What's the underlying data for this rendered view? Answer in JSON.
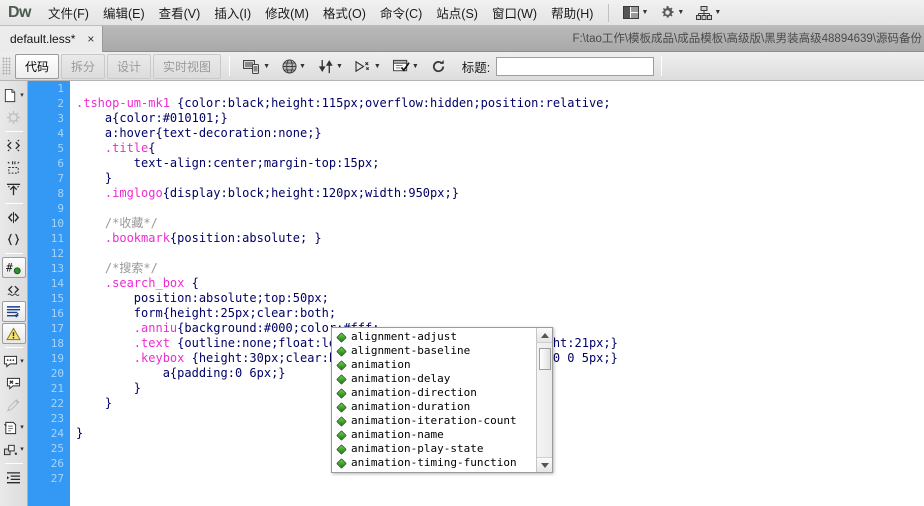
{
  "app": {
    "logo": "Dw",
    "window_path": "F:\\tao工作\\模板成品\\成品模板\\高级版\\黑男装高级48894639\\源码备份"
  },
  "menubar": {
    "items": [
      {
        "label": "文件(F)",
        "name": "menu-file"
      },
      {
        "label": "编辑(E)",
        "name": "menu-edit"
      },
      {
        "label": "查看(V)",
        "name": "menu-view"
      },
      {
        "label": "插入(I)",
        "name": "menu-insert"
      },
      {
        "label": "修改(M)",
        "name": "menu-modify"
      },
      {
        "label": "格式(O)",
        "name": "menu-format"
      },
      {
        "label": "命令(C)",
        "name": "menu-commands"
      },
      {
        "label": "站点(S)",
        "name": "menu-site"
      },
      {
        "label": "窗口(W)",
        "name": "menu-window"
      },
      {
        "label": "帮助(H)",
        "name": "menu-help"
      }
    ],
    "right_icons": [
      {
        "name": "layout-switcher-icon",
        "glyph": "layout"
      },
      {
        "name": "extend-gear-icon",
        "glyph": "gear"
      },
      {
        "name": "site-manage-icon",
        "glyph": "site"
      }
    ]
  },
  "tabbar": {
    "document_tab": {
      "label": "default.less*",
      "close": "×"
    }
  },
  "toolbar": {
    "view_buttons": [
      {
        "label": "代码",
        "active": true,
        "name": "view-code"
      },
      {
        "label": "拆分",
        "active": false,
        "name": "view-split"
      },
      {
        "label": "设计",
        "active": false,
        "name": "view-design"
      },
      {
        "label": "实时视图",
        "active": false,
        "name": "view-live"
      }
    ],
    "icons": [
      {
        "name": "multiscreen-preview-icon"
      },
      {
        "name": "preview-in-browser-icon"
      },
      {
        "name": "file-management-icon"
      },
      {
        "name": "live-code-icon"
      },
      {
        "name": "visual-aids-icon"
      },
      {
        "name": "refresh-icon"
      }
    ],
    "title_label": "标题:",
    "title_value": "",
    "title_placeholder": ""
  },
  "coding_toolbar": {
    "items": [
      {
        "name": "open-documents-icon",
        "glyph": "doc",
        "state": "normal"
      },
      {
        "name": "show-code-navigator-icon",
        "glyph": "wheel",
        "state": "disabled"
      },
      {
        "name": "collapse-full-tag-icon",
        "glyph": "collapse-tag",
        "state": "normal"
      },
      {
        "name": "collapse-outside-selection-icon",
        "glyph": "collapse-out",
        "state": "normal"
      },
      {
        "name": "expand-all-icon",
        "glyph": "expand",
        "state": "normal"
      },
      {
        "name": "select-parent-tag-icon",
        "glyph": "parent-tag",
        "state": "normal"
      },
      {
        "name": "balance-braces-icon",
        "glyph": "braces",
        "state": "normal"
      },
      {
        "name": "line-numbers-icon",
        "glyph": "hash",
        "state": "boxed"
      },
      {
        "name": "highlight-invalid-code-icon",
        "glyph": "invalid",
        "state": "normal"
      },
      {
        "name": "word-wrap-icon",
        "glyph": "wrap",
        "state": "boxed"
      },
      {
        "name": "syntax-error-alerts-icon",
        "glyph": "warn",
        "state": "boxed"
      },
      {
        "name": "apply-comment-icon",
        "glyph": "comment",
        "state": "normal"
      },
      {
        "name": "remove-comment-icon",
        "glyph": "uncomment",
        "state": "normal"
      },
      {
        "name": "wrap-tag-icon",
        "glyph": "pencil",
        "state": "disabled"
      },
      {
        "name": "recent-snippets-icon",
        "glyph": "snippet",
        "state": "normal"
      },
      {
        "name": "move-css-rules-icon",
        "glyph": "movecss",
        "state": "normal"
      },
      {
        "name": "indent-code-icon",
        "glyph": "indent",
        "state": "normal"
      }
    ]
  },
  "editor": {
    "line_numbers": [
      1,
      2,
      3,
      4,
      5,
      6,
      7,
      8,
      9,
      10,
      11,
      12,
      13,
      14,
      15,
      16,
      17,
      18,
      19,
      20,
      21,
      22,
      23,
      24,
      25,
      26,
      27
    ],
    "lines": [
      {
        "n": 1,
        "segments": []
      },
      {
        "n": 2,
        "segments": [
          {
            "t": ".tshop-um-mk1 ",
            "c": "tok-sel"
          },
          {
            "t": "{color:black;height:115px;overflow:hidden;position:relative;",
            "c": "tok-txt"
          }
        ]
      },
      {
        "n": 3,
        "segments": [
          {
            "t": "    a",
            "c": "tok-txt"
          },
          {
            "t": "{color:#010101;}",
            "c": "tok-txt"
          }
        ]
      },
      {
        "n": 4,
        "segments": [
          {
            "t": "    a:hover",
            "c": "tok-txt"
          },
          {
            "t": "{text-decoration:none;}",
            "c": "tok-txt"
          }
        ]
      },
      {
        "n": 5,
        "segments": [
          {
            "t": "    .title",
            "c": "tok-sel"
          },
          {
            "t": "{",
            "c": "tok-txt"
          }
        ]
      },
      {
        "n": 6,
        "segments": [
          {
            "t": "        text-align:center;margin-top:15px;",
            "c": "tok-txt"
          }
        ]
      },
      {
        "n": 7,
        "segments": [
          {
            "t": "    }",
            "c": "tok-txt"
          }
        ]
      },
      {
        "n": 8,
        "segments": [
          {
            "t": "    .imglogo",
            "c": "tok-sel"
          },
          {
            "t": "{display:block;height:120px;width:950px;}",
            "c": "tok-txt"
          }
        ]
      },
      {
        "n": 9,
        "segments": []
      },
      {
        "n": 10,
        "segments": [
          {
            "t": "    /*收藏*/",
            "c": "tok-cmt"
          }
        ]
      },
      {
        "n": 11,
        "segments": [
          {
            "t": "    .bookmark",
            "c": "tok-sel"
          },
          {
            "t": "{position:absolute; }",
            "c": "tok-txt"
          }
        ]
      },
      {
        "n": 12,
        "segments": []
      },
      {
        "n": 13,
        "segments": [
          {
            "t": "    /*搜索*/",
            "c": "tok-cmt"
          }
        ]
      },
      {
        "n": 14,
        "segments": [
          {
            "t": "    .search_box ",
            "c": "tok-sel"
          },
          {
            "t": "{",
            "c": "tok-txt"
          }
        ]
      },
      {
        "n": 15,
        "segments": [
          {
            "t": "        position:absolute;top:50px;",
            "c": "tok-txt"
          }
        ]
      },
      {
        "n": 16,
        "segments": [
          {
            "t": "        form",
            "c": "tok-txt"
          },
          {
            "t": "{height:25px;clear:both;",
            "c": "tok-txt"
          }
        ]
      },
      {
        "n": 17,
        "segments": [
          {
            "t": "        .anniu",
            "c": "tok-sel"
          },
          {
            "t": "{background:#000;color:#fff;",
            "c": "tok-txt"
          }
        ]
      },
      {
        "n": 18,
        "segments": [
          {
            "t": "        .text ",
            "c": "tok-sel"
          },
          {
            "t": "{outline:none;float:left;border:none;width:50px;height:21px;}",
            "c": "tok-txt"
          }
        ]
      },
      {
        "n": 19,
        "segments": [
          {
            "t": "        .keybox ",
            "c": "tok-sel"
          },
          {
            "t": "{height:30px;clear:both;background:#eee;padding:0 0 0 5px;}",
            "c": "tok-txt"
          }
        ]
      },
      {
        "n": 20,
        "segments": [
          {
            "t": "            a",
            "c": "tok-txt"
          },
          {
            "t": "{padding:0 6px;}",
            "c": "tok-txt"
          }
        ]
      },
      {
        "n": 21,
        "segments": [
          {
            "t": "        }",
            "c": "tok-txt"
          }
        ]
      },
      {
        "n": 22,
        "segments": [
          {
            "t": "    }",
            "c": "tok-txt"
          }
        ]
      },
      {
        "n": 23,
        "segments": []
      },
      {
        "n": 24,
        "segments": [
          {
            "t": "}",
            "c": "tok-txt"
          }
        ]
      },
      {
        "n": 25,
        "segments": []
      },
      {
        "n": 26,
        "segments": []
      },
      {
        "n": 27,
        "segments": []
      }
    ]
  },
  "autocomplete": {
    "items": [
      "alignment-adjust",
      "alignment-baseline",
      "animation",
      "animation-delay",
      "animation-direction",
      "animation-duration",
      "animation-iteration-count",
      "animation-name",
      "animation-play-state",
      "animation-timing-function"
    ],
    "scrollbar": {
      "up": "▲",
      "down": "▼"
    }
  },
  "colors": {
    "gutter_blue": "#3399f5",
    "selector_magenta": "#ee2bd3",
    "comment_gray": "#999999",
    "code_navy": "#000066",
    "bullet_green": "#1d7a12"
  }
}
